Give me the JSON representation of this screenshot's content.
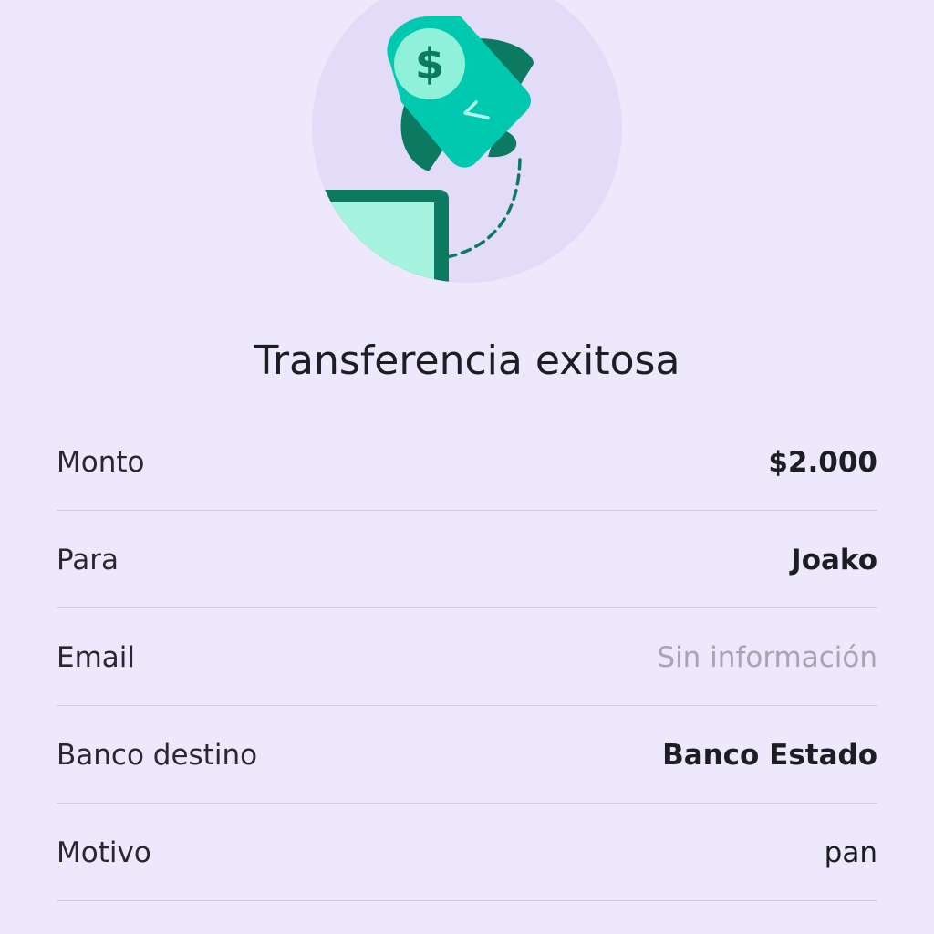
{
  "screen": {
    "title": "Transferencia exitosa",
    "illustration": {
      "icon": "dollar-tag-rocket-icon",
      "colors": {
        "circle": "#e3dcf8",
        "tag": "#00c9b0",
        "tag_dark": "#0b7a60",
        "screen_fill": "#a6f3df",
        "screen_frame": "#0b7a60",
        "coin": "#8ff1d9"
      }
    }
  },
  "details": [
    {
      "label": "Monto",
      "value": "$2.000"
    },
    {
      "label": "Para",
      "value": "Joako"
    },
    {
      "label": "Email",
      "value": "Sin información"
    },
    {
      "label": "Banco destino",
      "value": "Banco Estado"
    },
    {
      "label": "Motivo",
      "value": "pan"
    }
  ],
  "colors": {
    "background": "#ede8fb",
    "text_primary": "#1f1d24",
    "text_muted": "#a8a4b1",
    "divider": "#d3cedd"
  }
}
